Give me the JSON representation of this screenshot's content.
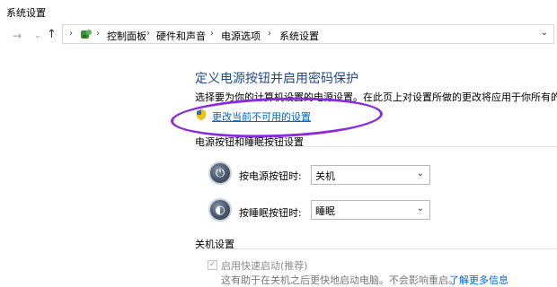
{
  "window": {
    "title": "系统设置"
  },
  "nav": {
    "back_icon": "back-arrow-icon",
    "forward_icon": "forward-arrow-icon",
    "recent_icon": "chevron-down-icon",
    "up_icon": "up-arrow-icon"
  },
  "breadcrumb": {
    "separator": "›",
    "items": [
      "控制面板",
      "硬件和声音",
      "电源选项",
      "系统设置"
    ]
  },
  "main": {
    "heading": "定义电源按钮并启用密码保护",
    "description": "选择要为你的计算机设置的电源设置。在此页上对设置所做的更改将应用于你所有的电",
    "change_link": "更改当前不可用的设置",
    "section_buttons": "电源按钮和睡眠按钮设置",
    "power_button_label": "按电源按钮时:",
    "power_button_value": "关机",
    "sleep_button_label": "按睡眠按钮时:",
    "sleep_button_value": "睡眠",
    "section_shutdown": "关机设置",
    "fast_startup_label": "启用快速启动(推荐)",
    "fast_startup_desc": "这有助于在关机之后更快地启动电脑。不会影响重启。",
    "learn_more": "了解更多信息"
  },
  "colors": {
    "heading": "#1e4b8c",
    "link": "#0066cc",
    "highlight_ellipse": "#8a2be2"
  }
}
